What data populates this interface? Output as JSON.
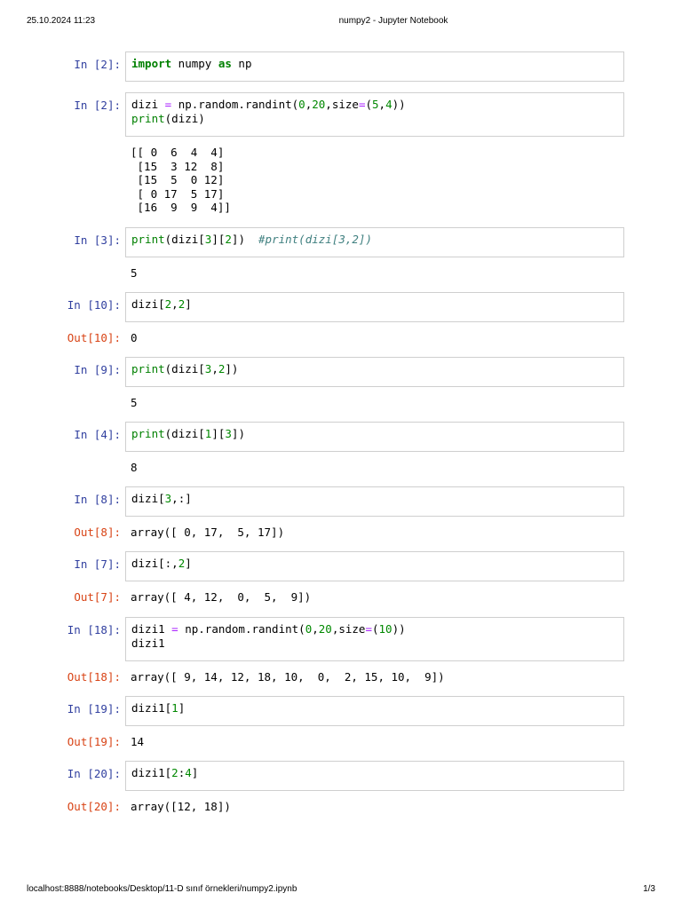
{
  "header": {
    "datetime": "25.10.2024 11:23",
    "title": "numpy2 - Jupyter Notebook"
  },
  "footer": {
    "url": "localhost:8888/notebooks/Desktop/11-D sınıf örnekleri/numpy2.ipynb",
    "page": "1/3"
  },
  "colors": {
    "in_prompt": "#303f9f",
    "out_prompt": "#d84315",
    "keyword": "#008000",
    "comment": "#408080",
    "operator": "#aa22ff"
  },
  "cells": [
    {
      "in": "In [2]:",
      "code": [
        [
          {
            "t": "import",
            "c": "kw"
          },
          {
            "t": " numpy ",
            "c": ""
          },
          {
            "t": "as",
            "c": "kw"
          },
          {
            "t": " np",
            "c": ""
          }
        ]
      ],
      "out_prompt": "",
      "output": []
    },
    {
      "in": "In [2]:",
      "code": [
        [
          {
            "t": "dizi ",
            "c": ""
          },
          {
            "t": "=",
            "c": "op"
          },
          {
            "t": " np.random.randint(",
            "c": ""
          },
          {
            "t": "0",
            "c": "num"
          },
          {
            "t": ",",
            "c": ""
          },
          {
            "t": "20",
            "c": "num"
          },
          {
            "t": ",size",
            "c": ""
          },
          {
            "t": "=",
            "c": "op"
          },
          {
            "t": "(",
            "c": ""
          },
          {
            "t": "5",
            "c": "num"
          },
          {
            "t": ",",
            "c": ""
          },
          {
            "t": "4",
            "c": "num"
          },
          {
            "t": "))",
            "c": ""
          }
        ],
        [
          {
            "t": "print",
            "c": "bi"
          },
          {
            "t": "(dizi)",
            "c": ""
          }
        ]
      ],
      "out_prompt": "",
      "output": [
        "[[ 0  6  4  4]",
        " [15  3 12  8]",
        " [15  5  0 12]",
        " [ 0 17  5 17]",
        " [16  9  9  4]]"
      ]
    },
    {
      "in": "In [3]:",
      "code": [
        [
          {
            "t": "print",
            "c": "bi"
          },
          {
            "t": "(dizi[",
            "c": ""
          },
          {
            "t": "3",
            "c": "num"
          },
          {
            "t": "][",
            "c": ""
          },
          {
            "t": "2",
            "c": "num"
          },
          {
            "t": "])  ",
            "c": ""
          },
          {
            "t": "#print(dizi[3,2])",
            "c": "cm"
          }
        ]
      ],
      "out_prompt": "",
      "output": [
        "5"
      ]
    },
    {
      "in": "In [10]:",
      "code": [
        [
          {
            "t": "dizi[",
            "c": ""
          },
          {
            "t": "2",
            "c": "num"
          },
          {
            "t": ",",
            "c": ""
          },
          {
            "t": "2",
            "c": "num"
          },
          {
            "t": "]",
            "c": ""
          }
        ]
      ],
      "out_prompt": "Out[10]:",
      "output": [
        "0"
      ]
    },
    {
      "in": "In [9]:",
      "code": [
        [
          {
            "t": "print",
            "c": "bi"
          },
          {
            "t": "(dizi[",
            "c": ""
          },
          {
            "t": "3",
            "c": "num"
          },
          {
            "t": ",",
            "c": ""
          },
          {
            "t": "2",
            "c": "num"
          },
          {
            "t": "])",
            "c": ""
          }
        ]
      ],
      "out_prompt": "",
      "output": [
        "5"
      ]
    },
    {
      "in": "In [4]:",
      "code": [
        [
          {
            "t": "print",
            "c": "bi"
          },
          {
            "t": "(dizi[",
            "c": ""
          },
          {
            "t": "1",
            "c": "num"
          },
          {
            "t": "][",
            "c": ""
          },
          {
            "t": "3",
            "c": "num"
          },
          {
            "t": "])",
            "c": ""
          }
        ]
      ],
      "out_prompt": "",
      "output": [
        "8"
      ]
    },
    {
      "in": "In [8]:",
      "code": [
        [
          {
            "t": "dizi[",
            "c": ""
          },
          {
            "t": "3",
            "c": "num"
          },
          {
            "t": ",:]",
            "c": ""
          }
        ]
      ],
      "out_prompt": "Out[8]:",
      "output": [
        "array([ 0, 17,  5, 17])"
      ]
    },
    {
      "in": "In [7]:",
      "code": [
        [
          {
            "t": "dizi[:,",
            "c": ""
          },
          {
            "t": "2",
            "c": "num"
          },
          {
            "t": "]",
            "c": ""
          }
        ]
      ],
      "out_prompt": "Out[7]:",
      "output": [
        "array([ 4, 12,  0,  5,  9])"
      ]
    },
    {
      "in": "In [18]:",
      "code": [
        [
          {
            "t": "dizi1 ",
            "c": ""
          },
          {
            "t": "=",
            "c": "op"
          },
          {
            "t": " np.random.randint(",
            "c": ""
          },
          {
            "t": "0",
            "c": "num"
          },
          {
            "t": ",",
            "c": ""
          },
          {
            "t": "20",
            "c": "num"
          },
          {
            "t": ",size",
            "c": ""
          },
          {
            "t": "=",
            "c": "op"
          },
          {
            "t": "(",
            "c": ""
          },
          {
            "t": "10",
            "c": "num"
          },
          {
            "t": "))",
            "c": ""
          }
        ],
        [
          {
            "t": "dizi1",
            "c": ""
          }
        ]
      ],
      "out_prompt": "Out[18]:",
      "output": [
        "array([ 9, 14, 12, 18, 10,  0,  2, 15, 10,  9])"
      ]
    },
    {
      "in": "In [19]:",
      "code": [
        [
          {
            "t": "dizi1[",
            "c": ""
          },
          {
            "t": "1",
            "c": "num"
          },
          {
            "t": "]",
            "c": ""
          }
        ]
      ],
      "out_prompt": "Out[19]:",
      "output": [
        "14"
      ]
    },
    {
      "in": "In [20]:",
      "code": [
        [
          {
            "t": "dizi1[",
            "c": ""
          },
          {
            "t": "2",
            "c": "num"
          },
          {
            "t": ":",
            "c": ""
          },
          {
            "t": "4",
            "c": "num"
          },
          {
            "t": "]",
            "c": ""
          }
        ]
      ],
      "out_prompt": "Out[20]:",
      "output": [
        "array([12, 18])"
      ]
    }
  ]
}
